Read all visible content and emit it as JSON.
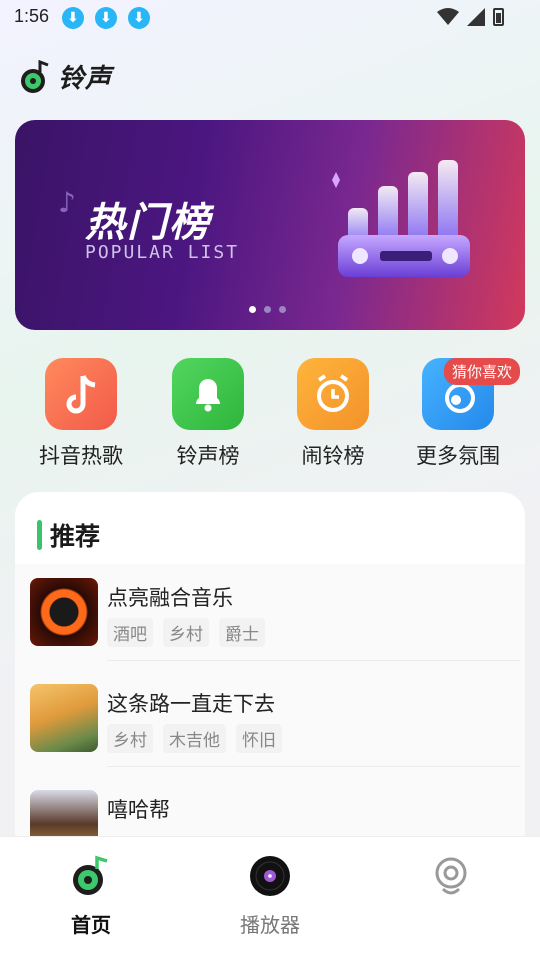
{
  "status_bar": {
    "time": "1:56",
    "download_icons": [
      "download-icon",
      "download-icon",
      "download-icon"
    ]
  },
  "header": {
    "app_name": "铃声"
  },
  "banner": {
    "title": "热门榜",
    "subtitle": "POPULAR LIST",
    "page_count": 3,
    "active_page": 1
  },
  "quick_links": [
    {
      "label": "抖音热歌",
      "icon": "tiktok-icon",
      "color": "#f56a4d"
    },
    {
      "label": "铃声榜",
      "icon": "bell-icon",
      "color": "#35c249"
    },
    {
      "label": "闹铃榜",
      "icon": "alarm-clock-icon",
      "color": "#f7a72a"
    },
    {
      "label": "更多氛围",
      "icon": "music-note-icon",
      "color": "#2b9df0",
      "badge": "猜你喜欢"
    }
  ],
  "recommend": {
    "title": "推荐",
    "songs": [
      {
        "title": "点亮融合音乐",
        "tags": [
          "酒吧",
          "乡村",
          "爵士"
        ]
      },
      {
        "title": "这条路一直走下去",
        "tags": [
          "乡村",
          "木吉他",
          "怀旧"
        ]
      },
      {
        "title": "嘻哈帮",
        "tags": []
      }
    ]
  },
  "bottom_nav": [
    {
      "label": "首页",
      "icon": "home-music-icon",
      "active": true
    },
    {
      "label": "播放器",
      "icon": "vinyl-record-icon",
      "active": false
    },
    {
      "label": "",
      "icon": "profile-icon",
      "active": false
    }
  ],
  "colors": {
    "accent": "#39c46b",
    "badge": "#e64b4b"
  }
}
